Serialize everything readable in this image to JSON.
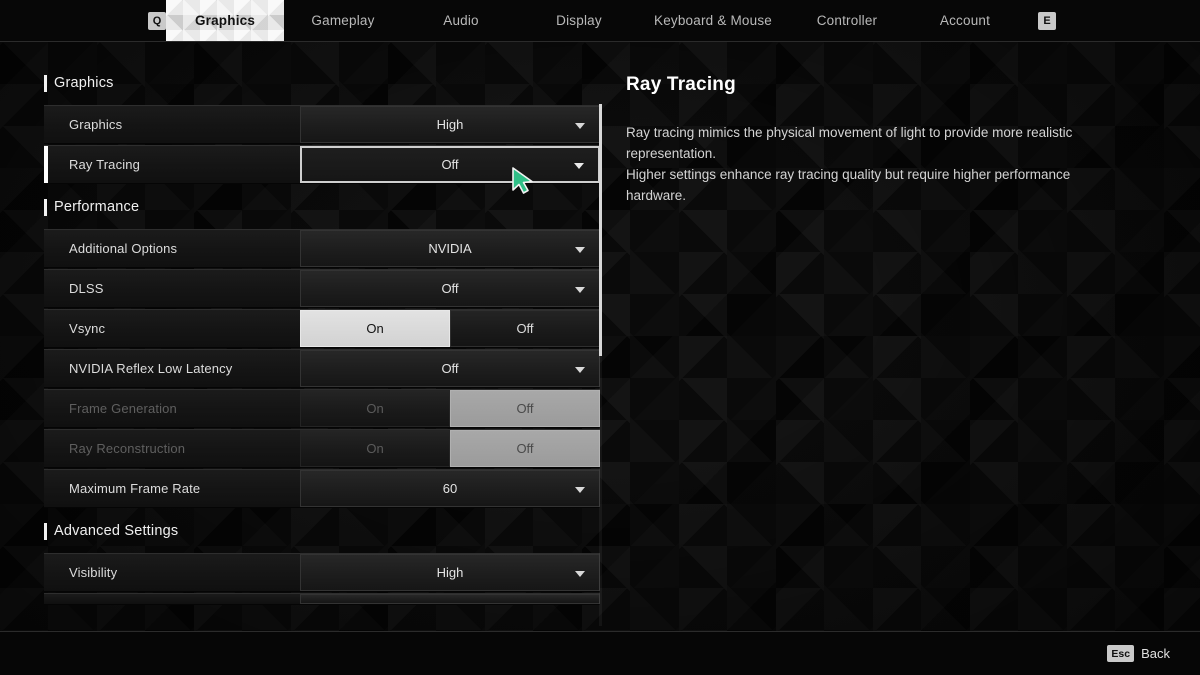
{
  "nav": {
    "prev_key": "Q",
    "next_key": "E",
    "tabs": [
      {
        "label": "Graphics",
        "active": true
      },
      {
        "label": "Gameplay",
        "active": false
      },
      {
        "label": "Audio",
        "active": false
      },
      {
        "label": "Display",
        "active": false
      },
      {
        "label": "Keyboard & Mouse",
        "active": false
      },
      {
        "label": "Controller",
        "active": false
      },
      {
        "label": "Account",
        "active": false
      }
    ]
  },
  "settings": {
    "sections": [
      {
        "title": "Graphics",
        "rows": [
          {
            "label": "Graphics",
            "type": "dropdown",
            "value": "High",
            "selected": false,
            "disabled": false
          },
          {
            "label": "Ray Tracing",
            "type": "dropdown",
            "value": "Off",
            "selected": true,
            "disabled": false
          }
        ]
      },
      {
        "title": "Performance",
        "rows": [
          {
            "label": "Additional Options",
            "type": "dropdown",
            "value": "NVIDIA",
            "selected": false,
            "disabled": false
          },
          {
            "label": "DLSS",
            "type": "dropdown",
            "value": "Off",
            "selected": false,
            "disabled": false
          },
          {
            "label": "Vsync",
            "type": "toggle",
            "options": [
              "On",
              "Off"
            ],
            "value": "On",
            "selected": false,
            "disabled": false
          },
          {
            "label": "NVIDIA Reflex Low Latency",
            "type": "dropdown",
            "value": "Off",
            "selected": false,
            "disabled": false
          },
          {
            "label": "Frame Generation",
            "type": "toggle",
            "options": [
              "On",
              "Off"
            ],
            "value": "Off",
            "selected": false,
            "disabled": true
          },
          {
            "label": "Ray Reconstruction",
            "type": "toggle",
            "options": [
              "On",
              "Off"
            ],
            "value": "Off",
            "selected": false,
            "disabled": true
          },
          {
            "label": "Maximum Frame Rate",
            "type": "dropdown",
            "value": "60",
            "selected": false,
            "disabled": false
          }
        ]
      },
      {
        "title": "Advanced Settings",
        "rows": [
          {
            "label": "Visibility",
            "type": "dropdown",
            "value": "High",
            "selected": false,
            "disabled": false
          },
          {
            "label": "",
            "type": "clipped",
            "value": "",
            "selected": false,
            "disabled": false
          }
        ]
      }
    ]
  },
  "detail": {
    "title": "Ray Tracing",
    "paragraphs": [
      "Ray tracing mimics the physical movement of light to provide more realistic representation.",
      "Higher settings enhance ray tracing quality but require higher performance hardware."
    ]
  },
  "footer": {
    "back_key": "Esc",
    "back_label": "Back"
  },
  "colors": {
    "accent_selected": "#ffffff",
    "toggle_on_bg": "#d8d8d8",
    "cursor": "#2fbf87",
    "panel_bg": "#0a0a0a"
  }
}
